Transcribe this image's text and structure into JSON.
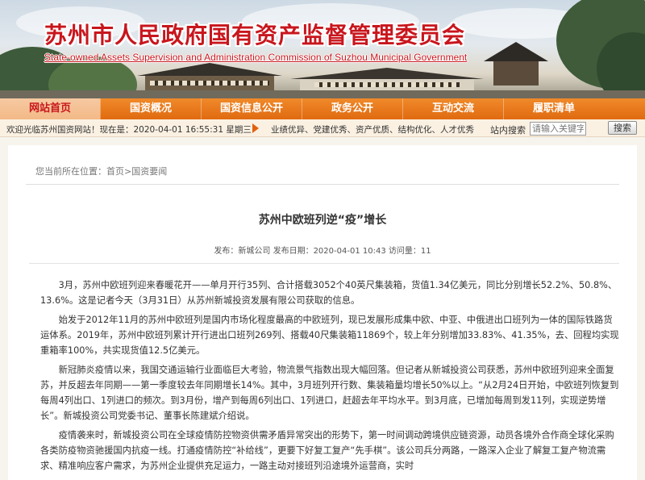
{
  "banner": {
    "title": "苏州市人民政府国有资产监督管理委员会",
    "subtitle": "State-owned Assets Supervision and Administration Commission of Suzhou Municipal Government"
  },
  "nav": {
    "items": [
      {
        "label": "网站首页",
        "active": true
      },
      {
        "label": "国资概况",
        "active": false
      },
      {
        "label": "国资信息公开",
        "active": false
      },
      {
        "label": "政务公开",
        "active": false
      },
      {
        "label": "互动交流",
        "active": false
      },
      {
        "label": "履职清单",
        "active": false
      }
    ]
  },
  "infobar": {
    "welcome": "欢迎光临苏州国资网站！现在是：2020-04-01 16:55:31 星期三",
    "slogan": "业绩优异、党建优秀、资产优质、结构优化、人才优秀",
    "search_label": "站内搜索",
    "search_placeholder": "请输入关键字",
    "search_button": "搜索"
  },
  "breadcrumb": {
    "prefix": "您当前所在位置：",
    "path": "首页>国资要闻"
  },
  "article": {
    "title": "苏州中欧班列逆“疫”增长",
    "meta": "发布：新城公司   发布日期：2020-04-01 10:43   访问量：11",
    "paragraphs": [
      "3月，苏州中欧班列迎来春暖花开——单月开行35列、合计搭载3052个40英尺集装箱，货值1.34亿美元，同比分别增长52.2%、50.8%、13.6%。这是记者今天（3月31日）从苏州新城投资发展有限公司获取的信息。",
      "始发于2012年11月的苏州中欧班列是国内市场化程度最高的中欧班列，现已发展形成集中欧、中亚、中俄进出口班列为一体的国际铁路货运体系。2019年，苏州中欧班列累计开行进出口班列269列、搭载40尺集装箱11869个，较上年分别增加33.83%、41.35%，去、回程均实现重箱率100%，共实现货值12.5亿美元。",
      "新冠肺炎疫情以来，我国交通运输行业面临巨大考验，物流景气指数出现大幅回落。但记者从新城投资公司获悉，苏州中欧班列迎来全面复苏，并反超去年同期——第一季度较去年同期增长14%。其中，3月班列开行数、集装箱量均增长50%以上。“从2月24日开始，中欧班列恢复到每周4列出口、1列进口的频次。到3月份，增产到每周6列出口、1列进口，赶超去年平均水平。到3月底，已增加每周到发11列，实现逆势增长”。新城投资公司党委书记、董事长陈建斌介绍说。",
      "疫情袭来时，新城投资公司在全球疫情防控物资供需矛盾异常突出的形势下，第一时间调动跨境供应链资源，动员各境外合作商全球化采购各类防疫物资驰援国内抗疫一线。打通疫情防控“补给线”，更要下好复工复产“先手棋”。该公司兵分两路，一路深入企业了解复工复产物流需求、精准响应客户需求，为苏州企业提供充足运力，一路主动对接班列沿途境外运营商，实时"
    ]
  },
  "colors": {
    "brand_red": "#c8161d",
    "nav_orange": "#e06a10",
    "nav_active_bg": "#f3b987"
  }
}
